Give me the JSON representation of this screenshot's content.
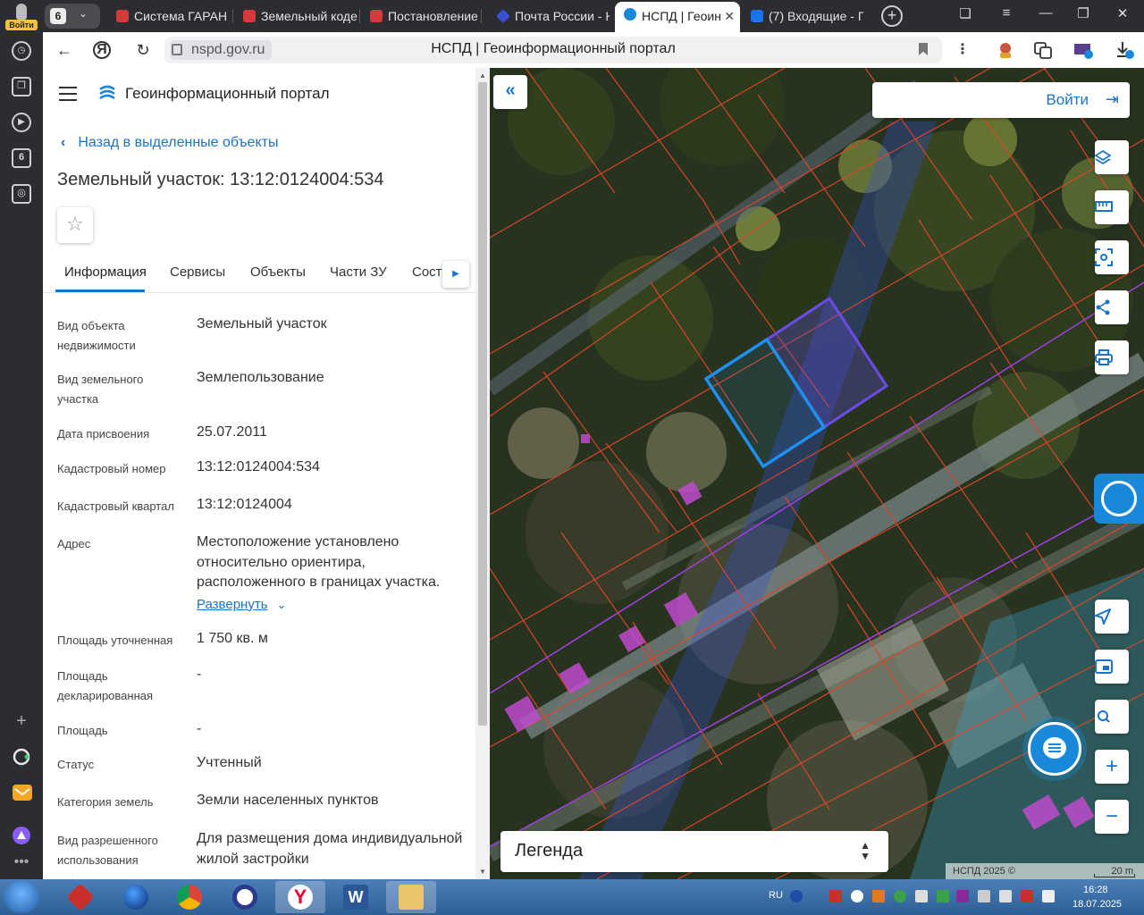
{
  "browser": {
    "login_label": "Войти",
    "tab_count": "6",
    "tabs": [
      {
        "label": "Система ГАРАН",
        "color": "#d43a3a"
      },
      {
        "label": "Земельный кодe",
        "color": "#d43a3a"
      },
      {
        "label": "Постановление",
        "color": "#d43a3a"
      },
      {
        "label": "Почта России - Н",
        "color": "#3a4fd4"
      },
      {
        "label": "НСПД | Геоин",
        "color": "#1a88d8"
      },
      {
        "label": "(7) Входящие - Г",
        "color": "#1a73e8"
      }
    ],
    "address": {
      "domain": "nspd.gov.ru",
      "page_title": "НСПД | Геоинформационный портал"
    },
    "rail_badge": "6"
  },
  "panel": {
    "portal_title": "Геоинформационный портал",
    "back_link": "Назад в выделенные объекты",
    "object_title": "Земельный участок: 13:12:0124004:534",
    "tabs": [
      {
        "label": "Информация"
      },
      {
        "label": "Сервисы"
      },
      {
        "label": "Объекты"
      },
      {
        "label": "Части ЗУ"
      },
      {
        "label": "Соста"
      }
    ],
    "fields": [
      {
        "key": "Вид объекта недвижимости",
        "value": "Земельный участок"
      },
      {
        "key": "Вид земельного участка",
        "value": "Землепользование"
      },
      {
        "key": "Дата присвоения",
        "value": "25.07.2011"
      },
      {
        "key": "Кадастровый номер",
        "value": "13:12:0124004:534"
      },
      {
        "key": "Кадастровый квартал",
        "value": "13:12:0124004"
      },
      {
        "key": "Адрес",
        "value": "Местоположение установлено относительно ориентира, расположенного в границах участка."
      },
      {
        "key": "Площадь уточненная",
        "value": "1 750 кв. м"
      },
      {
        "key": "Площадь декларированная",
        "value": "-"
      },
      {
        "key": "Площадь",
        "value": "-"
      },
      {
        "key": "Статус",
        "value": "Учтенный"
      },
      {
        "key": "Категория земель",
        "value": "Земли населенных пунктов"
      },
      {
        "key": "Вид разрешенного использования",
        "value": "Для размещения дома индивидуальной жилой застройки"
      }
    ],
    "expand_label": "Развернуть"
  },
  "map": {
    "login_label": "Войти",
    "legend_label": "Легенда",
    "attribution": "НСПД 2025 ©",
    "scale_label": "20 m",
    "parcel_color": "#1f8ff0",
    "boundary_color": "#e0452a"
  },
  "taskbar": {
    "lang": "RU",
    "time": "16:28",
    "date": "18.07.2025"
  }
}
